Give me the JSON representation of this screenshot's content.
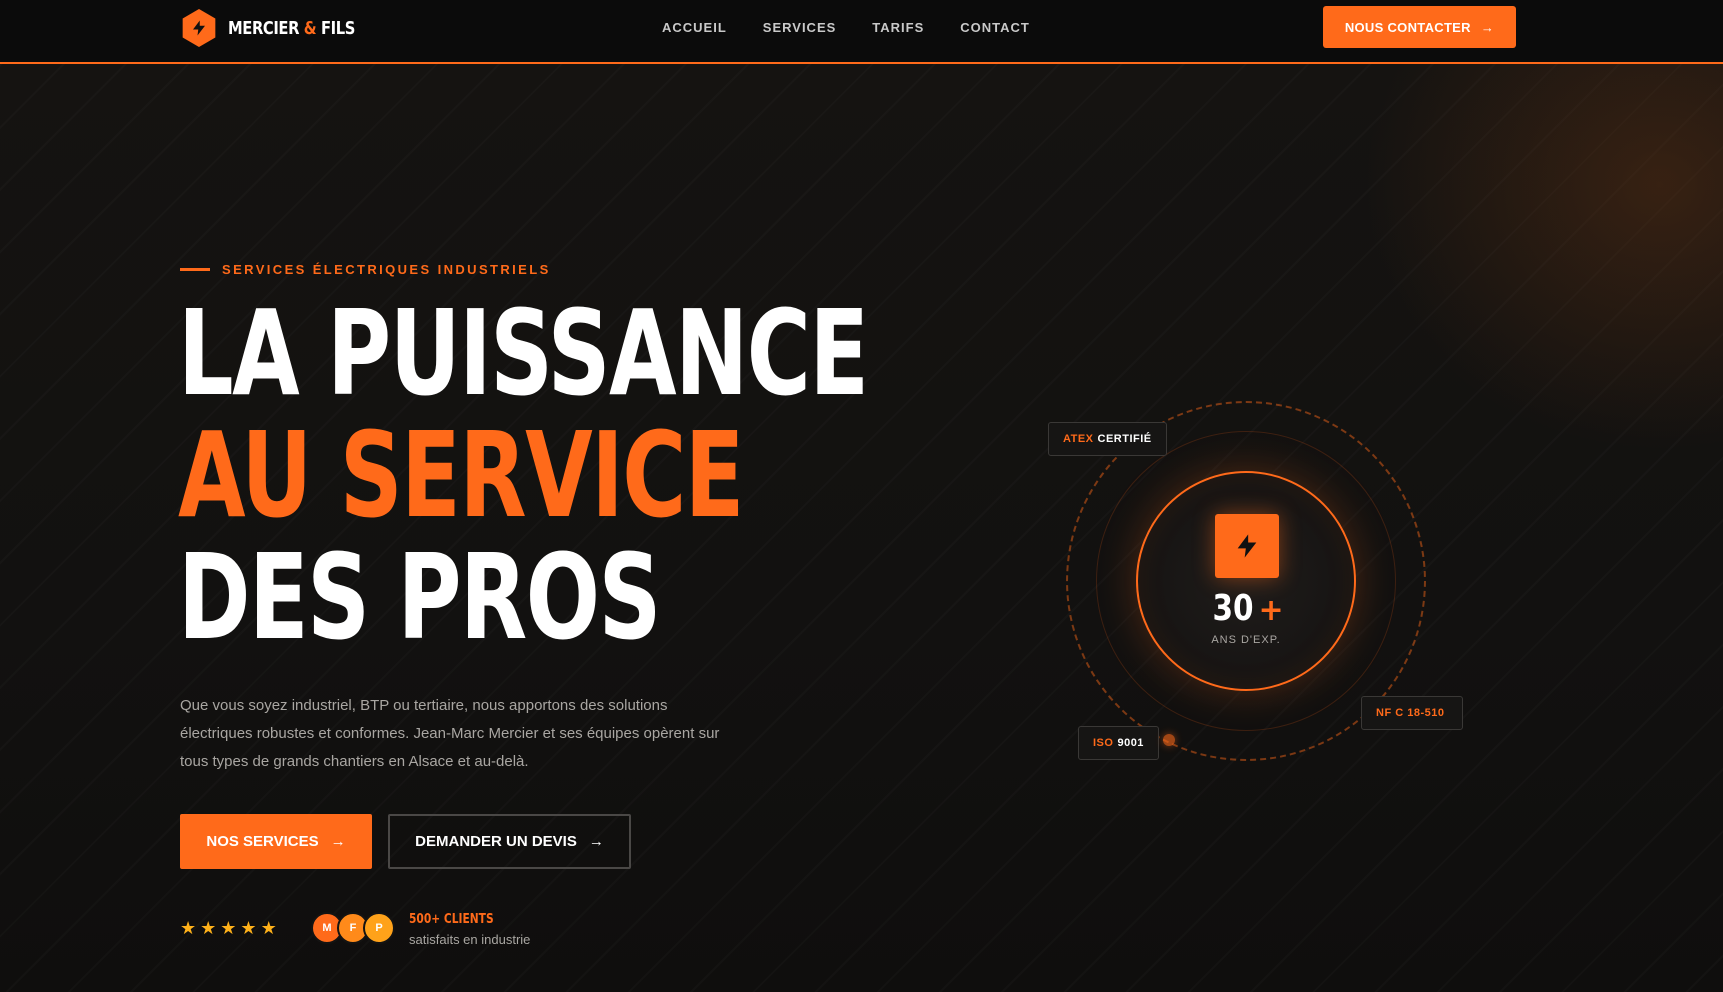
{
  "brand": {
    "name_part1": "MERCIER",
    "ampersand": "&",
    "name_part2": "FILS",
    "accent_color": "#ff6a1a"
  },
  "nav": {
    "items": [
      "ACCUEIL",
      "SERVICES",
      "TARIFS",
      "CONTACT"
    ],
    "cta_label": "NOUS CONTACTER"
  },
  "hero": {
    "eyebrow": "SERVICES ÉLECTRIQUES INDUSTRIELS",
    "headline_line1": "LA PUISSANCE",
    "headline_line2": "AU SERVICE",
    "headline_line3": "DES PROS",
    "description": "Que vous soyez industriel, BTP ou tertiaire, nous apportons des solutions électriques robustes et conformes. Jean-Marc Mercier et ses équipes opèrent sur tous types de grands chantiers en Alsace et au-delà.",
    "primary_button": "NOS SERVICES",
    "secondary_button": "DEMANDER UN DEVIS",
    "rating": 5,
    "avatars": [
      "M",
      "F",
      "P"
    ],
    "clients_title": "500+ CLIENTS",
    "clients_sub": "satisfaits en industrie"
  },
  "badge": {
    "years": "30",
    "plus": "+",
    "label": "ANS D'EXP.",
    "tags": {
      "atex": {
        "orange": "ATEX",
        "white": "CERTIFIÉ"
      },
      "iso": {
        "orange": "ISO",
        "white": "9001"
      },
      "nfc": {
        "orange": "NF C 18-510"
      }
    }
  },
  "icons": {
    "logo": "bolt-icon",
    "arrow": "arrow-right-icon",
    "star": "star-icon"
  }
}
